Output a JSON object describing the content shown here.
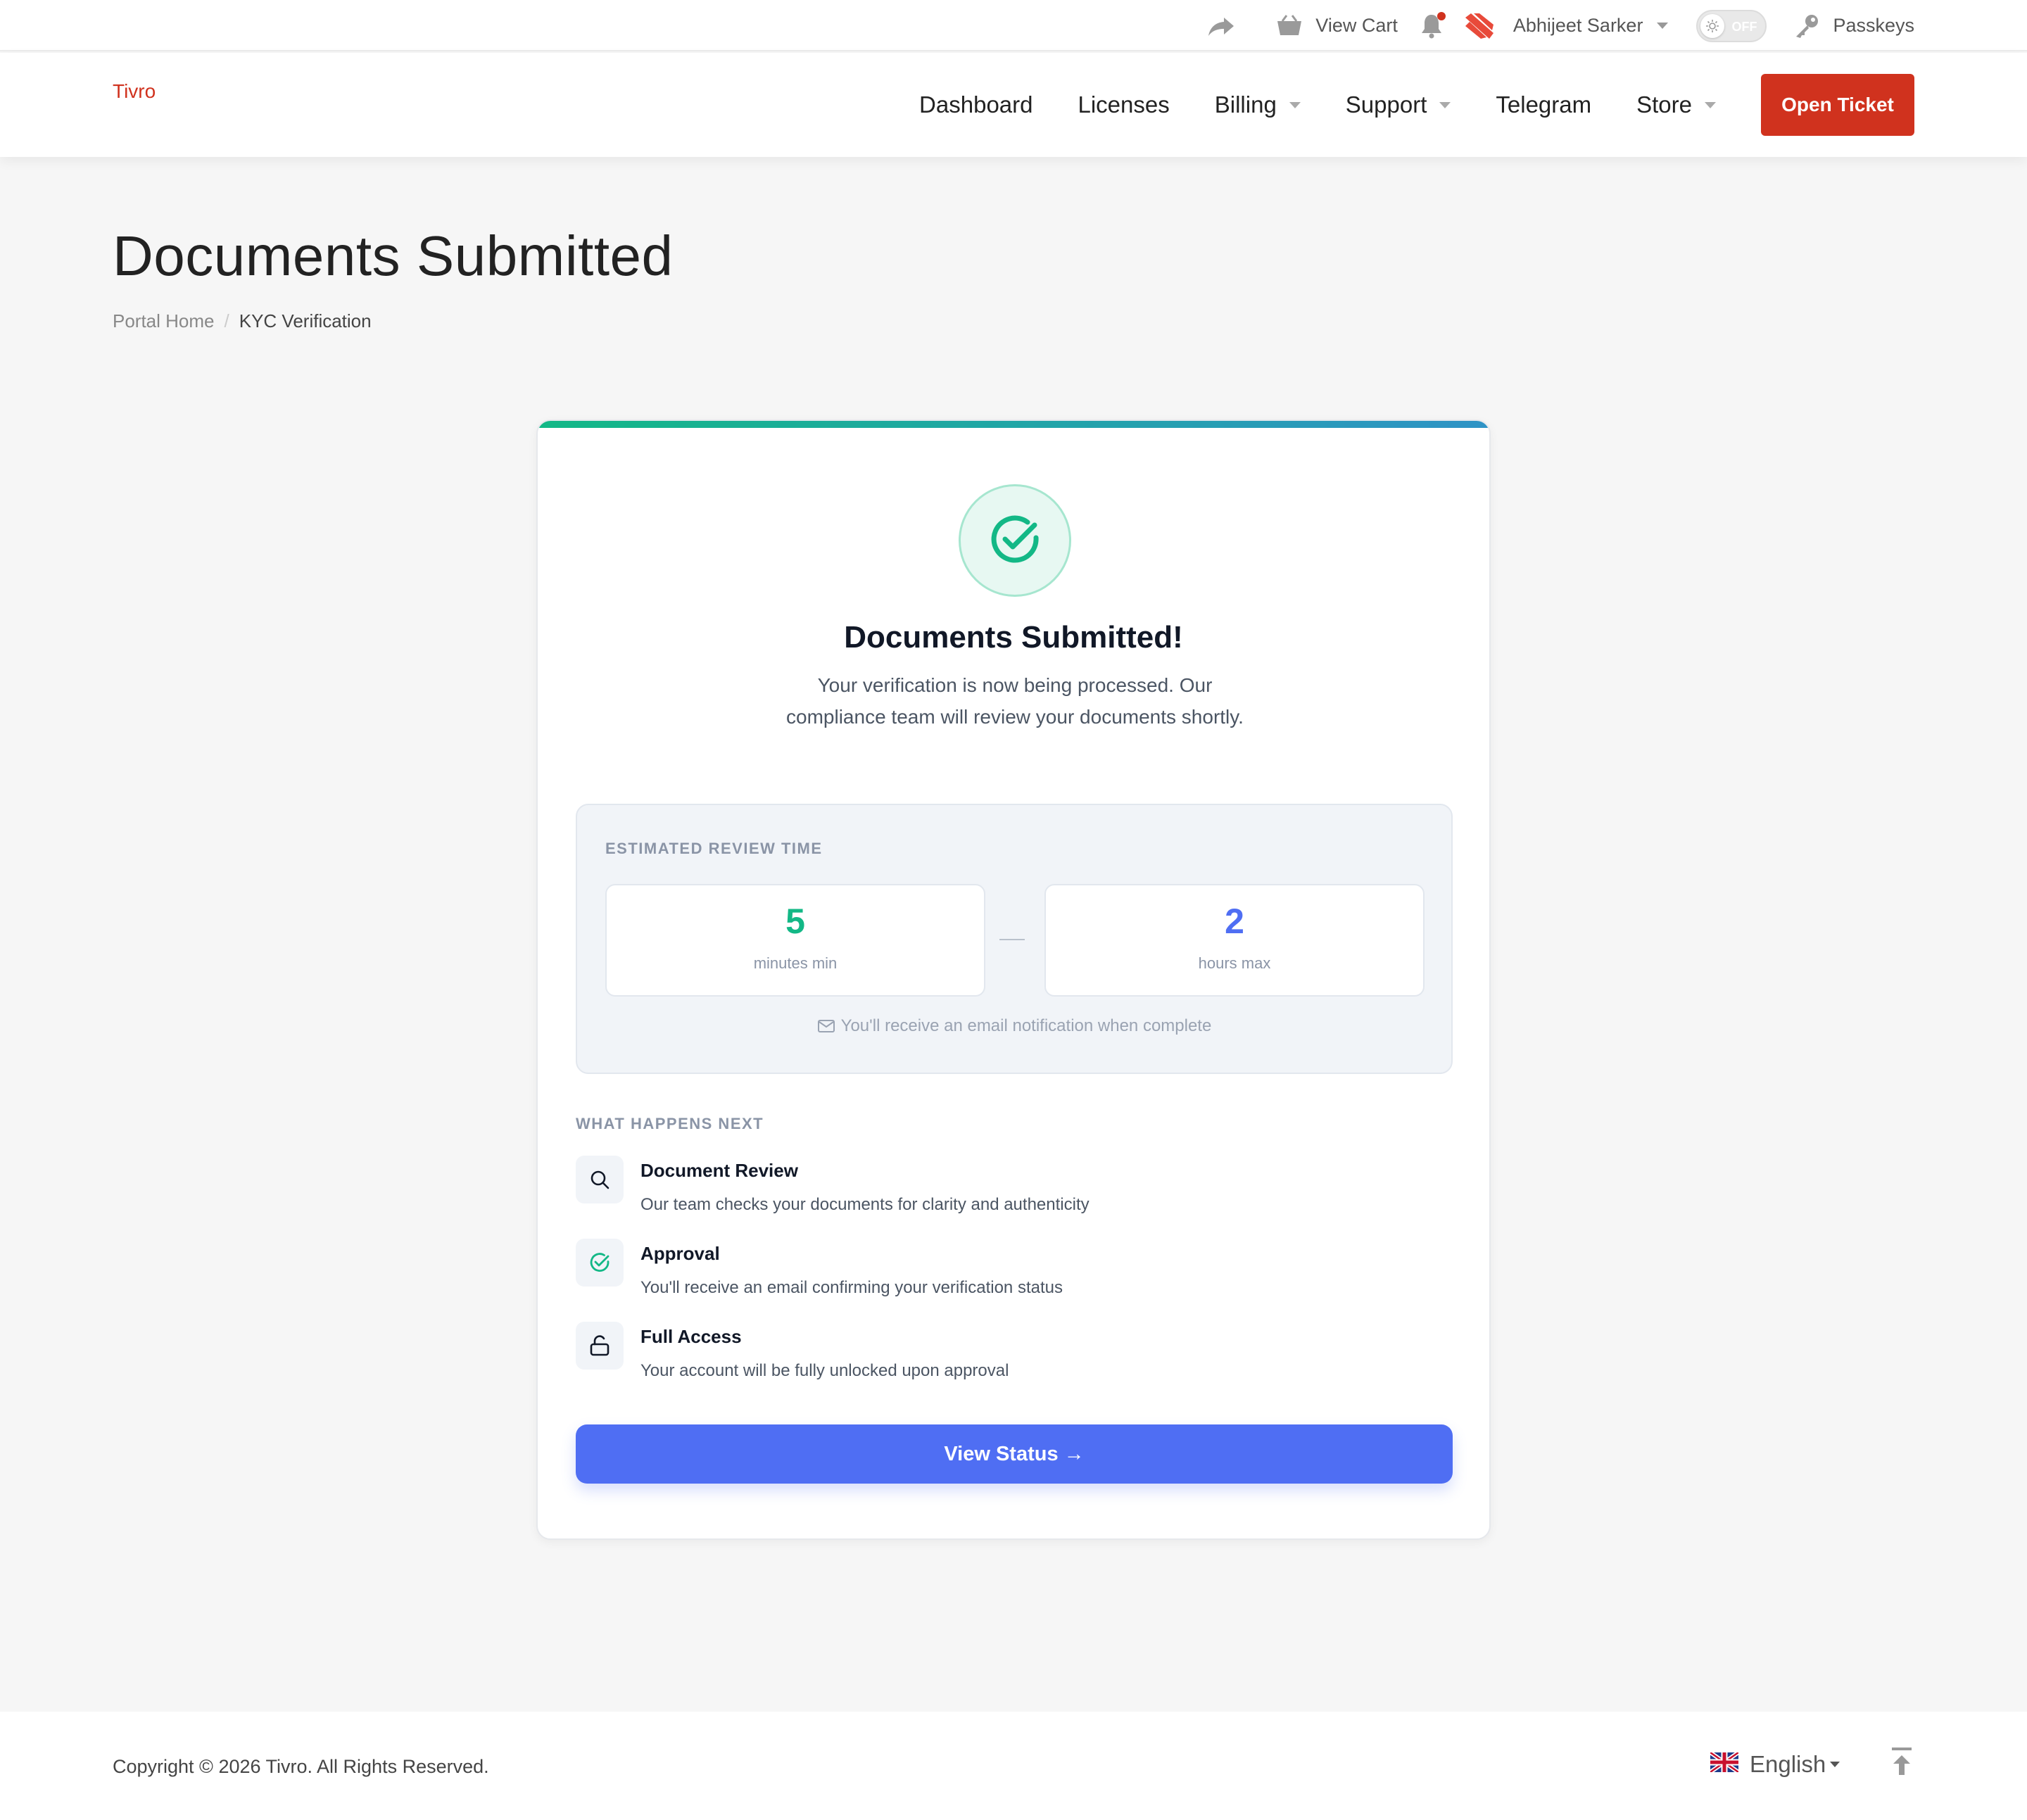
{
  "topbar": {
    "view_cart": "View Cart",
    "user_name": "Abhijeet Sarker",
    "theme_toggle": "OFF",
    "passkeys": "Passkeys"
  },
  "header": {
    "logo": "Tivro",
    "nav": {
      "dashboard": "Dashboard",
      "licenses": "Licenses",
      "billing": "Billing",
      "support": "Support",
      "telegram": "Telegram",
      "store": "Store"
    },
    "open_ticket": "Open Ticket"
  },
  "page": {
    "title": "Documents Submitted",
    "breadcrumb": {
      "home": "Portal Home",
      "separator": "/",
      "current": "KYC Verification"
    }
  },
  "card": {
    "title": "Documents Submitted!",
    "description": "Your verification is now being processed. Our compliance team will review your documents shortly.",
    "review": {
      "label": "ESTIMATED REVIEW TIME",
      "min_value": "5",
      "min_unit": "minutes min",
      "max_value": "2",
      "max_unit": "hours max",
      "note": "You'll receive an email notification when complete"
    },
    "next": {
      "label": "WHAT HAPPENS NEXT",
      "steps": [
        {
          "title": "Document Review",
          "desc": "Our team checks your documents for clarity and authenticity"
        },
        {
          "title": "Approval",
          "desc": "You'll receive an email confirming your verification status"
        },
        {
          "title": "Full Access",
          "desc": "Your account will be fully unlocked upon approval"
        }
      ]
    },
    "cta": "View Status →"
  },
  "footer": {
    "copyright": "Copyright © 2026 Tivro. All Rights Reserved.",
    "language": "English"
  },
  "colors": {
    "brand": "#d0321e",
    "success": "#13b886",
    "primary": "#4f6ef3"
  },
  "icons": [
    "share-icon",
    "cart-icon",
    "bell-icon",
    "brand-mark-icon",
    "sun-icon",
    "key-icon",
    "check-circle-icon",
    "mail-icon",
    "search-icon",
    "lock-open-icon",
    "uk-flag-icon",
    "arrow-up-to-top-icon"
  ]
}
